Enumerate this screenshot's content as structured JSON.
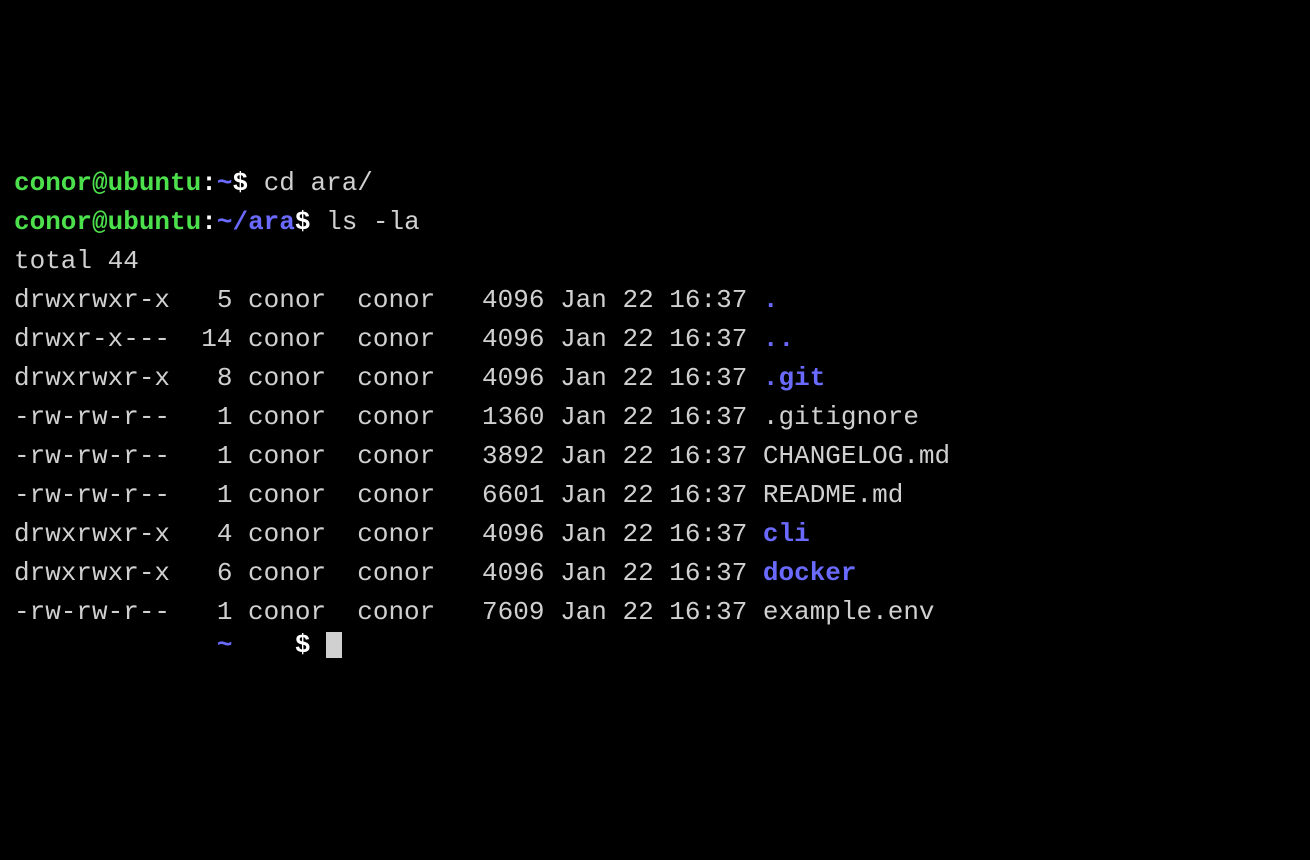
{
  "prompt1": {
    "user": "conor",
    "at": "@",
    "host": "ubuntu",
    "colon": ":",
    "path": "~",
    "dollar": "$",
    "command": "cd ara/"
  },
  "prompt2": {
    "user": "conor",
    "at": "@",
    "host": "ubuntu",
    "colon": ":",
    "path": "~/ara",
    "dollar": "$",
    "command": "ls -la"
  },
  "total_line": "total 44",
  "listing": [
    {
      "perms": "drwxrwxr-x",
      "links": "5",
      "owner": "conor",
      "group": "conor",
      "size": "4096",
      "month": "Jan",
      "day": "22",
      "time": "16:37",
      "name": ".",
      "type": "dir"
    },
    {
      "perms": "drwxr-x---",
      "links": "14",
      "owner": "conor",
      "group": "conor",
      "size": "4096",
      "month": "Jan",
      "day": "22",
      "time": "16:37",
      "name": "..",
      "type": "dir"
    },
    {
      "perms": "drwxrwxr-x",
      "links": "8",
      "owner": "conor",
      "group": "conor",
      "size": "4096",
      "month": "Jan",
      "day": "22",
      "time": "16:37",
      "name": ".git",
      "type": "dir"
    },
    {
      "perms": "-rw-rw-r--",
      "links": "1",
      "owner": "conor",
      "group": "conor",
      "size": "1360",
      "month": "Jan",
      "day": "22",
      "time": "16:37",
      "name": ".gitignore",
      "type": "file"
    },
    {
      "perms": "-rw-rw-r--",
      "links": "1",
      "owner": "conor",
      "group": "conor",
      "size": "3892",
      "month": "Jan",
      "day": "22",
      "time": "16:37",
      "name": "CHANGELOG.md",
      "type": "file"
    },
    {
      "perms": "-rw-rw-r--",
      "links": "1",
      "owner": "conor",
      "group": "conor",
      "size": "6601",
      "month": "Jan",
      "day": "22",
      "time": "16:37",
      "name": "README.md",
      "type": "file"
    },
    {
      "perms": "drwxrwxr-x",
      "links": "4",
      "owner": "conor",
      "group": "conor",
      "size": "4096",
      "month": "Jan",
      "day": "22",
      "time": "16:37",
      "name": "cli",
      "type": "dir"
    },
    {
      "perms": "drwxrwxr-x",
      "links": "6",
      "owner": "conor",
      "group": "conor",
      "size": "4096",
      "month": "Jan",
      "day": "22",
      "time": "16:37",
      "name": "docker",
      "type": "dir"
    },
    {
      "perms": "-rw-rw-r--",
      "links": "1",
      "owner": "conor",
      "group": "conor",
      "size": "7609",
      "month": "Jan",
      "day": "22",
      "time": "16:37",
      "name": "example.env",
      "type": "file"
    }
  ],
  "prompt3": {
    "user_frag": "",
    "host_frag": "",
    "path_frag": "~",
    "dollar": "$"
  }
}
